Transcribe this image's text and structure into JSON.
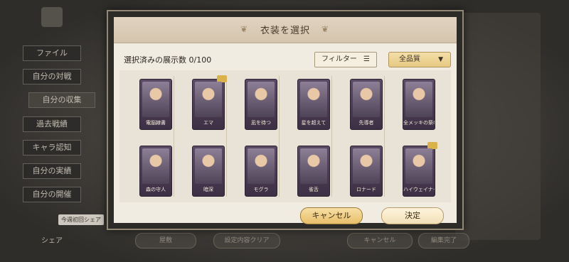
{
  "background": {
    "sidebar_items": [
      "ファイル",
      "自分の対戦",
      "自分の収集",
      "過去戦績",
      "キャラ認知",
      "自分の実績",
      "自分の開催"
    ],
    "share_tip": "今週初回シェア",
    "share_label": "シェア",
    "bottom_buttons": [
      "屋敷",
      "設定内容クリア",
      "キャンセル",
      "編集完了"
    ]
  },
  "dialog": {
    "title": "衣装を選択",
    "count_label": "選択済みの展示数 0/100",
    "filter_label": "フィルター",
    "quality_label": "全品質",
    "cancel_label": "キャンセル",
    "ok_label": "決定"
  },
  "costumes": [
    {
      "name": "電脳隷書"
    },
    {
      "name": "エマ"
    },
    {
      "name": "凪を待つ"
    },
    {
      "name": "星を超えて"
    },
    {
      "name": "先導者"
    },
    {
      "name": "全メッキの祭者"
    },
    {
      "name": "森の守人"
    },
    {
      "name": "暗深"
    },
    {
      "name": "モグラ"
    },
    {
      "name": "雀舌"
    },
    {
      "name": "ロナード"
    },
    {
      "name": "ハイウェイナイト"
    }
  ],
  "colors": {
    "accent_gold": "#e8bf6a",
    "card_purple": "#4f3f58",
    "dialog_bg": "#f1ece2"
  }
}
